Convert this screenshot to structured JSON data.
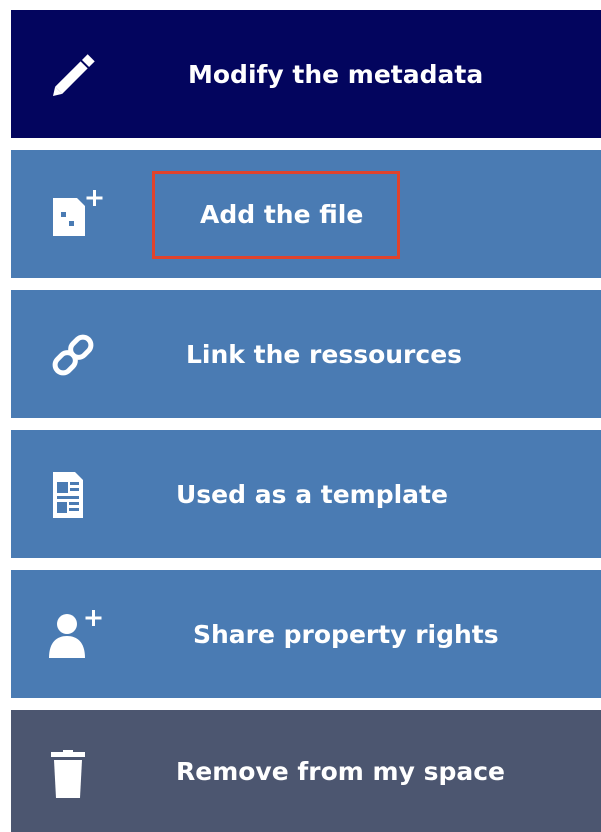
{
  "menu": {
    "items": [
      {
        "label": "Modify the metadata",
        "icon": "pencil-icon",
        "color": "#03055e"
      },
      {
        "label": "Add the file",
        "icon": "add-file-icon",
        "color": "#4a7bb3",
        "highlighted": true
      },
      {
        "label": "Link the ressources",
        "icon": "link-icon",
        "color": "#4a7bb3"
      },
      {
        "label": "Used as a template",
        "icon": "template-icon",
        "color": "#4a7bb3"
      },
      {
        "label": "Share property rights",
        "icon": "add-user-icon",
        "color": "#4a7bb3"
      },
      {
        "label": "Remove from my space",
        "icon": "trash-icon",
        "color": "#4c5670"
      }
    ]
  },
  "colors": {
    "primary_dark": "#03055e",
    "action_blue": "#4a7bb3",
    "danger_slate": "#4c5670",
    "highlight_border": "#e0432c",
    "text": "#ffffff"
  }
}
